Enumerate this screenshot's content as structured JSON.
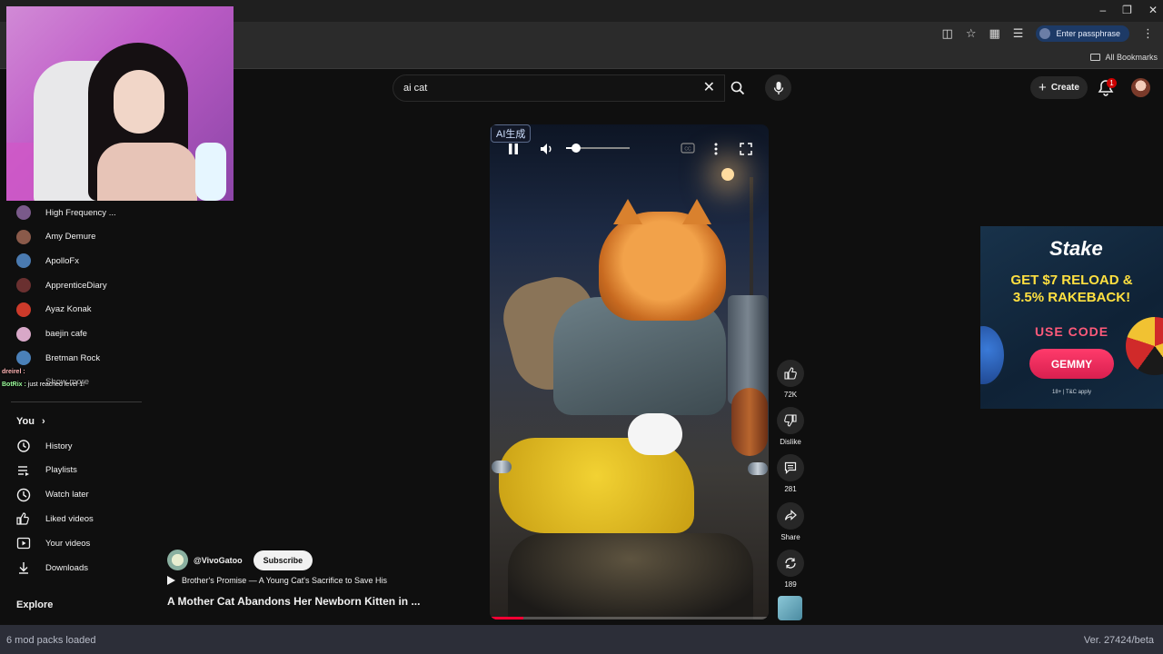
{
  "browser": {
    "passphrase_label": "Enter passphrase",
    "bookmarks_label": "All Bookmarks"
  },
  "search": {
    "query": "ai cat"
  },
  "header": {
    "create_label": "Create",
    "notification_count": "1"
  },
  "sidebar": {
    "subscriptions": [
      {
        "name": "High Frequency ...",
        "color": "#7a5a8a"
      },
      {
        "name": "Amy Demure",
        "color": "#8a5a4a"
      },
      {
        "name": "ApolloFx",
        "color": "#4a7ab0"
      },
      {
        "name": "ApprenticeDiary",
        "color": "#6a3030"
      },
      {
        "name": "Ayaz Konak",
        "color": "#cc3a2a"
      },
      {
        "name": "baejin cafe",
        "color": "#d8a8c8"
      },
      {
        "name": "Bretman Rock",
        "color": "#4a80b8"
      }
    ],
    "show_more": "Show more",
    "chat": [
      {
        "user": "dreirel :",
        "text": ""
      },
      {
        "user": "BotRix :",
        "text": "just reached level 1!"
      }
    ],
    "you_section": "You",
    "you_chevron": "›",
    "nav": [
      {
        "label": "History",
        "icon": "history-icon"
      },
      {
        "label": "Playlists",
        "icon": "playlists-icon"
      },
      {
        "label": "Watch later",
        "icon": "watch-later-icon"
      },
      {
        "label": "Liked videos",
        "icon": "liked-icon"
      },
      {
        "label": "Your videos",
        "icon": "your-videos-icon"
      },
      {
        "label": "Downloads",
        "icon": "downloads-icon"
      }
    ],
    "explore_section": "Explore"
  },
  "video": {
    "ai_tag": "AI生成",
    "volume": 0.15,
    "progress": 0.12
  },
  "actions": {
    "likes": "72K",
    "dislike": "Dislike",
    "comments": "281",
    "share": "Share",
    "remix": "189"
  },
  "channel": {
    "name": "@VivoGatoo",
    "subscribe": "Subscribe",
    "playlist_title": "Brother's Promise — A Young Cat's Sacrifice to Save His",
    "video_title": "A Mother Cat Abandons Her Newborn Kitten in ..."
  },
  "ad": {
    "brand": "Stake",
    "headline_1": "GET $7 RELOAD &",
    "headline_2": "3.5% RAKEBACK!",
    "use_code": "USE CODE",
    "cta": "GEMMY",
    "fine_print": "18+ | T&C apply"
  },
  "statusbar": {
    "left": "6 mod packs loaded",
    "right": "Ver. 27424/beta"
  },
  "colors": {
    "background": "#0f0f0f",
    "accent_red": "#ff0033",
    "ad_accent": "#ff3b6b",
    "ad_yellow": "#ffe040"
  }
}
